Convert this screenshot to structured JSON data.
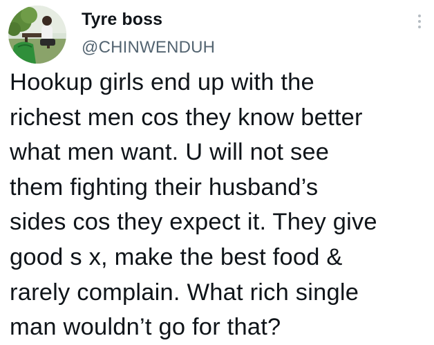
{
  "tweet": {
    "author": {
      "display_name": "Tyre boss",
      "handle": "@CHINWENDUH",
      "avatar_icon": "profile-photo"
    },
    "more_icon": "vertical-ellipsis-icon",
    "text": "Hookup girls end up with the\nrichest men cos they know better\nwhat men want. U will not see\nthem fighting their husband’s\nsides cos they expect it. They give\ngood s x, make the best food &\nrarely complain. What rich single\nman wouldn’t go for that?"
  },
  "colors": {
    "text": "#0f1419",
    "secondary_text": "#536471",
    "background": "#ffffff"
  }
}
